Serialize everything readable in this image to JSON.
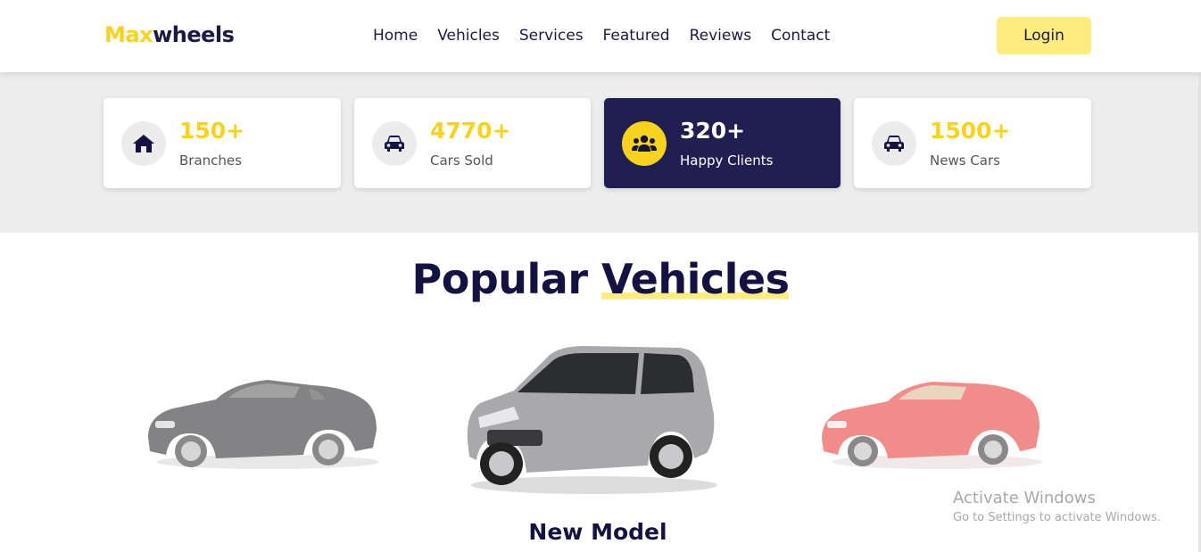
{
  "header": {
    "logo_part1": "Max",
    "logo_part2": "wheels",
    "nav": [
      "Home",
      "Vehicles",
      "Services",
      "Featured",
      "Reviews",
      "Contact"
    ],
    "login_label": "Login"
  },
  "stats": [
    {
      "value": "150+",
      "label": "Branches",
      "icon": "home-icon"
    },
    {
      "value": "4770+",
      "label": "Cars Sold",
      "icon": "car-icon"
    },
    {
      "value": "320+",
      "label": "Happy Clients",
      "icon": "users-icon"
    },
    {
      "value": "1500+",
      "label": "News Cars",
      "icon": "car-icon"
    }
  ],
  "section": {
    "title_part1": "Popular",
    "title_part2": "Vehicles"
  },
  "slider": {
    "caption": "New Model",
    "cars": [
      "black-convertible",
      "silver-suv",
      "red-convertible"
    ]
  },
  "watermark": {
    "line1": "Activate Windows",
    "line2": "Go to Settings to activate Windows."
  },
  "colors": {
    "accent": "#f8d31b",
    "dark": "#211e51",
    "login_bg": "#fdec7e"
  }
}
